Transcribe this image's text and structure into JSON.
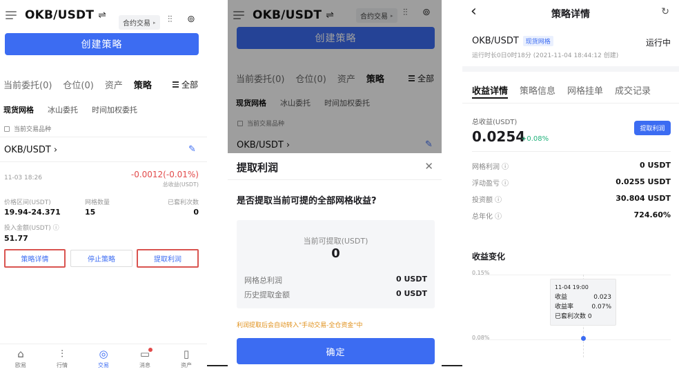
{
  "colors": {
    "accent": "#3c6cf2",
    "negative": "#e24a4a",
    "positive": "#1fb27a",
    "highlight_border": "#d9534f"
  },
  "p1": {
    "pair": "OKB/USDT",
    "swap_icon": "⇌",
    "contract_pill": "合约交易",
    "create_btn": "创建策略",
    "tabs": [
      "当前委托(0)",
      "仓位(0)",
      "资产",
      "策略"
    ],
    "all_label": "全部",
    "subtabs": [
      "现货网格",
      "冰山委托",
      "时间加权委托"
    ],
    "current_only": "当前交易品种",
    "strategy_pair": "OKB/USDT ›",
    "date": "11-03 18:26",
    "pnl": "-0.0012(-0.01%)",
    "pnl_label": "总收益(USDT)",
    "range_label": "价格区间(USDT)",
    "range_value": "19.94-24.371",
    "grid_label": "网格数量",
    "grid_value": "15",
    "arb_label": "已套利次数",
    "arb_value": "0",
    "invest_label": "投入金额(USDT) ⓘ",
    "invest_value": "51.77",
    "btn_detail": "策略详情",
    "btn_stop": "停止策略",
    "btn_withdraw": "提取利润",
    "nav": [
      {
        "label": "欧易",
        "icon": "⌂"
      },
      {
        "label": "行情",
        "icon": "⫶"
      },
      {
        "label": "交易",
        "icon": "◎"
      },
      {
        "label": "消息",
        "icon": "▭"
      },
      {
        "label": "资产",
        "icon": "▯"
      }
    ]
  },
  "p2": {
    "pair": "OKB/USDT",
    "contract_pill": "合约交易",
    "create_btn": "创建策略",
    "tabs": [
      "当前委托(0)",
      "仓位(0)",
      "资产",
      "策略"
    ],
    "all_label": "全部",
    "subtabs": [
      "现货网格",
      "冰山委托",
      "时间加权委托"
    ],
    "current_only": "当前交易品种",
    "strategy_pair": "OKB/USDT ›",
    "sheet_title": "提取利润",
    "close_icon": "✕",
    "question": "是否提取当前可提的全部网格收益?",
    "available_label": "当前可提取(USDT)",
    "available_value": "0",
    "grid_profit_label": "网格总利润",
    "grid_profit_value": "0 USDT",
    "history_label": "历史提取金额",
    "history_value": "0 USDT",
    "note": "利润提取后会自动转入\"手动交易-全仓资金\"中",
    "confirm": "确定"
  },
  "p3": {
    "back_icon": "‹",
    "title": "策略详情",
    "pair": "OKB/USDT",
    "tag": "现货网格",
    "status": "运行中",
    "runtime": "运行时长0日0时18分 (2021-11-04 18:44:12 创建)",
    "tabs": [
      "收益详情",
      "策略信息",
      "网格挂单",
      "成交记录"
    ],
    "total_label": "总收益(USDT)",
    "total_value": "0.0254",
    "total_pct": "+0.08%",
    "withdraw_btn": "提取利润",
    "rows": [
      {
        "k": "网格利润 ⓘ",
        "v": "0 USDT"
      },
      {
        "k": "浮动盈亏 ⓘ",
        "v": "0.0255 USDT"
      },
      {
        "k": "投资额 ⓘ",
        "v": "30.804 USDT"
      },
      {
        "k": "总年化 ⓘ",
        "v": "724.60%"
      }
    ],
    "chart_title": "收益变化",
    "y_top": "0.15%",
    "y_bottom": "0.08%",
    "tooltip": {
      "date": "11-04 19:00",
      "profit_label": "收益",
      "profit_value": "0.023",
      "rate_label": "收益率",
      "rate_value": "0.07%",
      "arb_label": "已套利次数",
      "arb_value": "0"
    }
  }
}
